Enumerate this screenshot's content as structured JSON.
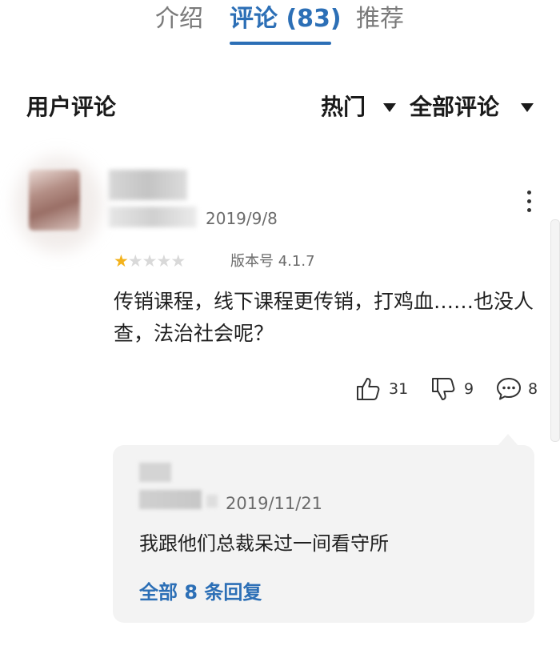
{
  "tabs": [
    {
      "label": "介绍",
      "active": false
    },
    {
      "label": "评论 (83)",
      "active": true
    },
    {
      "label": "推荐",
      "active": false
    }
  ],
  "section_title": "用户评论",
  "filters": {
    "sort": "热门",
    "scope": "全部评论"
  },
  "review": {
    "date": "2019/9/8",
    "rating": 1,
    "rating_max": 5,
    "version": "版本号 4.1.7",
    "text": "传销课程，线下课程更传销，打鸡血……也没人查，法治社会呢？",
    "likes": "31",
    "dislikes": "9",
    "replies": "8"
  },
  "reply": {
    "date": "2019/11/21",
    "text": "我跟他们总裁呆过一间看守所",
    "all_replies_link": "全部 8 条回复"
  },
  "colors": {
    "accent": "#2c6fb6",
    "star": "#f3b21c",
    "reply_bg": "#f3f3f3"
  },
  "icons": [
    "thumbs-up-icon",
    "thumbs-down-icon",
    "comment-icon",
    "more-vertical-icon",
    "caret-down-icon",
    "star-icon"
  ]
}
